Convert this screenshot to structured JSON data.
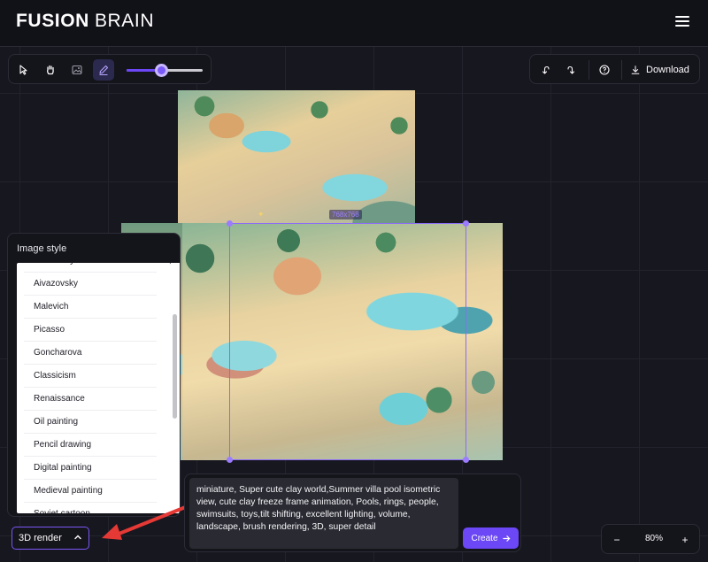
{
  "header": {
    "logo_bold": "FUSION",
    "logo_light": "BRAIN",
    "menu_icon": "hamburger-menu-icon"
  },
  "toolbar": {
    "tools": [
      {
        "name": "select-tool",
        "icon": "cursor-arrow-icon",
        "active": false
      },
      {
        "name": "hand-tool",
        "icon": "hand-icon",
        "active": false
      },
      {
        "name": "image-tool",
        "icon": "image-icon",
        "active": false
      },
      {
        "name": "eraser-tool",
        "icon": "pencil-eraser-icon",
        "active": true
      }
    ],
    "brush_size_fraction": 0.45,
    "undo_icon": "undo-icon",
    "redo_icon": "redo-icon",
    "help_icon": "question-circle-icon",
    "download_label": "Download",
    "download_icon": "download-arrow-icon"
  },
  "canvas": {
    "selection_size_label": "768x768"
  },
  "style_panel": {
    "title": "Image style",
    "items": [
      "Kandinsky",
      "Aivazovsky",
      "Malevich",
      "Picasso",
      "Goncharova",
      "Classicism",
      "Renaissance",
      "Oil painting",
      "Pencil drawing",
      "Digital painting",
      "Medieval painting",
      "Soviet cartoon"
    ],
    "selected": "3D render",
    "selected_icon": "chevron-up-icon"
  },
  "prompt": {
    "text": "miniature, Super cute clay world,Summer villa pool isometric view, cute clay freeze frame animation, Pools, rings, people, swimsuits, toys,tilt shifting, excellent lighting, volume, landscape, brush rendering, 3D, super detail",
    "create_label": "Create",
    "create_icon": "arrow-right-icon"
  },
  "zoom": {
    "value": "80%",
    "minus": "−",
    "plus": "+"
  },
  "colors": {
    "accent": "#6b47f5",
    "selection": "#8b6cf7",
    "annotation_arrow": "#e53935"
  }
}
